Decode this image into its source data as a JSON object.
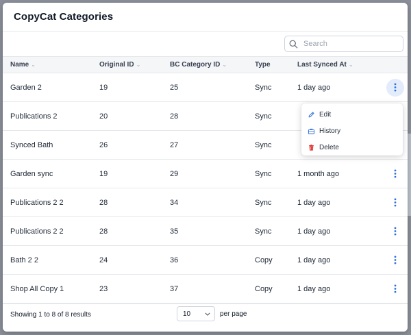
{
  "modal": {
    "title": "CopyCat Categories"
  },
  "search": {
    "placeholder": "Search",
    "value": ""
  },
  "table": {
    "columns": [
      {
        "label": "Name",
        "sortable": true
      },
      {
        "label": "Original ID",
        "sortable": true
      },
      {
        "label": "BC Category ID",
        "sortable": true
      },
      {
        "label": "Type",
        "sortable": false
      },
      {
        "label": "Last Synced At",
        "sortable": true
      }
    ],
    "rows": [
      {
        "name": "Garden 2",
        "original_id": "19",
        "bc_category_id": "25",
        "type": "Sync",
        "last_synced": "1 day ago"
      },
      {
        "name": "Publications 2",
        "original_id": "20",
        "bc_category_id": "28",
        "type": "Sync",
        "last_synced": ""
      },
      {
        "name": "Synced Bath",
        "original_id": "26",
        "bc_category_id": "27",
        "type": "Sync",
        "last_synced": ""
      },
      {
        "name": "Garden sync",
        "original_id": "19",
        "bc_category_id": "29",
        "type": "Sync",
        "last_synced": "1 month ago"
      },
      {
        "name": "Publications 2 2",
        "original_id": "28",
        "bc_category_id": "34",
        "type": "Sync",
        "last_synced": "1 day ago"
      },
      {
        "name": "Publications 2 2",
        "original_id": "28",
        "bc_category_id": "35",
        "type": "Sync",
        "last_synced": "1 day ago"
      },
      {
        "name": "Bath 2 2",
        "original_id": "24",
        "bc_category_id": "36",
        "type": "Copy",
        "last_synced": "1 day ago"
      },
      {
        "name": "Shop All Copy 1",
        "original_id": "23",
        "bc_category_id": "37",
        "type": "Copy",
        "last_synced": "1 day ago"
      }
    ]
  },
  "row_menu": {
    "items": [
      {
        "label": "Edit",
        "icon": "pencil-icon"
      },
      {
        "label": "History",
        "icon": "briefcase-icon"
      },
      {
        "label": "Delete",
        "icon": "trash-icon"
      }
    ]
  },
  "footer": {
    "results_text": "Showing 1 to 8 of 8 results",
    "per_page_value": "10",
    "per_page_label": "per page"
  },
  "colors": {
    "accent": "#2f6fd8",
    "delete": "#dc2626",
    "kebab_active_bg": "#e3ecfb"
  }
}
